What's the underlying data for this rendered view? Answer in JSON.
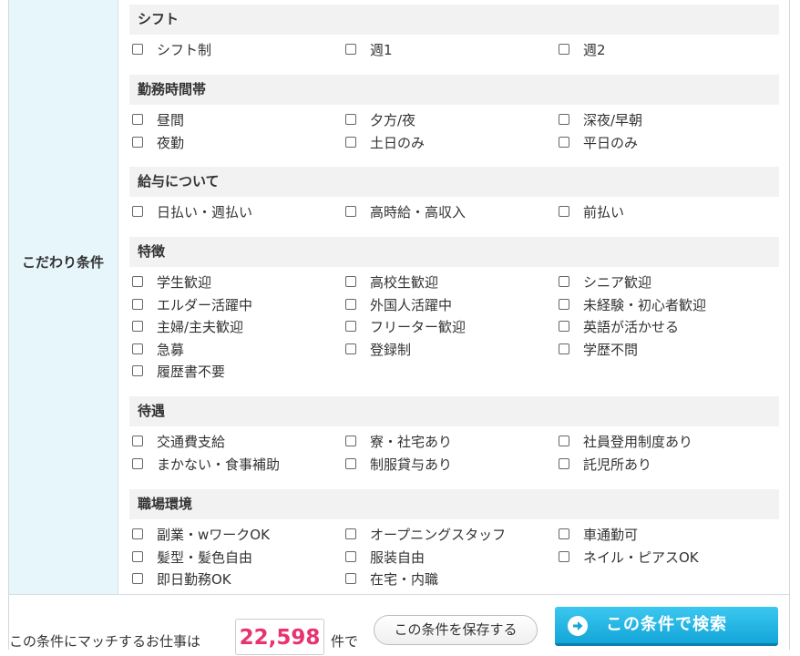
{
  "side_label": "こだわり条件",
  "sections": [
    {
      "title": "シフト",
      "rows": [
        [
          "シフト制",
          "週1",
          "週2"
        ]
      ]
    },
    {
      "title": "勤務時間帯",
      "rows": [
        [
          "昼間",
          "夕方/夜",
          "深夜/早朝"
        ],
        [
          "夜勤",
          "土日のみ",
          "平日のみ"
        ]
      ]
    },
    {
      "title": "給与について",
      "rows": [
        [
          "日払い・週払い",
          "高時給・高収入",
          "前払い"
        ]
      ]
    },
    {
      "title": "特徴",
      "rows": [
        [
          "学生歓迎",
          "高校生歓迎",
          "シニア歓迎"
        ],
        [
          "エルダー活躍中",
          "外国人活躍中",
          "未経験・初心者歓迎"
        ],
        [
          "主婦/主夫歓迎",
          "フリーター歓迎",
          "英語が活かせる"
        ],
        [
          "急募",
          "登録制",
          "学歴不問"
        ],
        [
          "履歴書不要"
        ]
      ]
    },
    {
      "title": "待遇",
      "rows": [
        [
          "交通費支給",
          "寮・社宅あり",
          "社員登用制度あり"
        ],
        [
          "まかない・食事補助",
          "制服貸与あり",
          "託児所あり"
        ]
      ]
    },
    {
      "title": "職場環境",
      "rows": [
        [
          "副業・wワークOK",
          "オープニングスタッフ",
          "車通勤可"
        ],
        [
          "髪型・髪色自由",
          "服装自由",
          "ネイル・ピアスOK"
        ],
        [
          "即日勤務OK",
          "在宅・内職"
        ]
      ]
    }
  ],
  "footer": {
    "match_text": "この条件にマッチするお仕事は",
    "count": "22,598",
    "count_suffix": "件で",
    "save_button": "この条件を保存する",
    "search_button": "この条件で検索"
  },
  "colors": {
    "side_bg": "#e6f6fb",
    "header_bg": "#f2f2f2",
    "count_color": "#e8336e",
    "search_button": "#13a6d9"
  },
  "icons": {
    "search_button_icon": "arrow-right-circle-icon",
    "checkbox": "checkbox-unchecked-icon"
  }
}
